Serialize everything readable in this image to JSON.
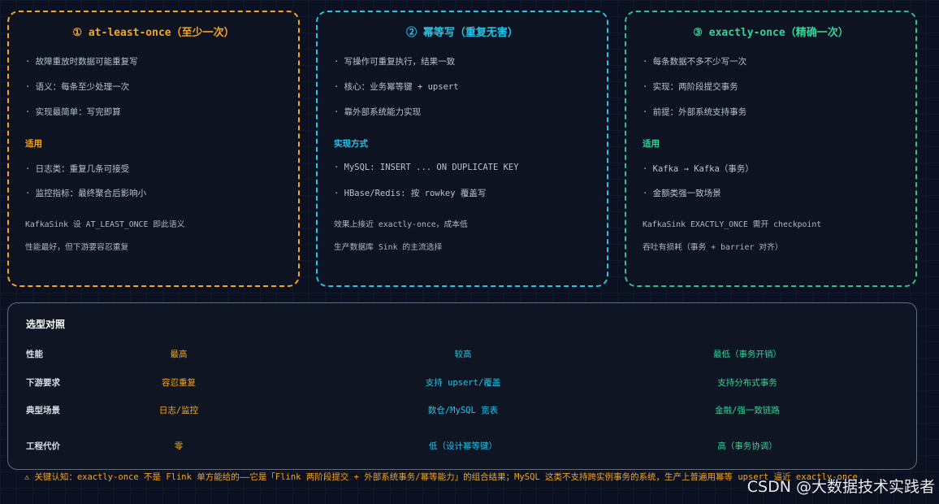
{
  "cards": [
    {
      "title": "① at-least-once（至少一次）",
      "points": [
        "· 故障重放时数据可能重复写",
        "· 语义：每条至少处理一次",
        "· 实现最简单：写完即算"
      ],
      "section": "适用",
      "items": [
        "· 日志类：重复几条可接受",
        "· 监控指标：最终聚合后影响小"
      ],
      "notes": [
        "KafkaSink 设 AT_LEAST_ONCE 即此语义",
        "性能最好，但下游要容忍重复"
      ]
    },
    {
      "title": "② 幂等写（重复无害）",
      "points": [
        "· 写操作可重复执行，结果一致",
        "· 核心：业务幂等键 + upsert",
        "· 靠外部系统能力实现"
      ],
      "section": "实现方式",
      "items": [
        "· MySQL: INSERT ... ON DUPLICATE KEY",
        "· HBase/Redis: 按 rowkey 覆盖写"
      ],
      "notes": [
        "效果上接近 exactly-once，成本低",
        "生产数据库 Sink 的主流选择"
      ]
    },
    {
      "title": "③ exactly-once（精确一次）",
      "points": [
        "· 每条数据不多不少写一次",
        "· 实现：两阶段提交事务",
        "· 前提：外部系统支持事务"
      ],
      "section": "适用",
      "items": [
        "· Kafka → Kafka（事务）",
        "· 金额类强一致场景"
      ],
      "notes": [
        "KafkaSink EXACTLY_ONCE 需开 checkpoint",
        "吞吐有损耗（事务 + barrier 对齐）"
      ]
    }
  ],
  "compare": {
    "title": "选型对照",
    "rows": [
      {
        "label": "性能",
        "v1": "最高",
        "v2": "较高",
        "v3": "最低（事务开销）"
      },
      {
        "label": "下游要求",
        "v1": "容忍重复",
        "v2": "支持 upsert/覆盖",
        "v3": "支持分布式事务"
      },
      {
        "label": "典型场景",
        "v1": "日志/监控",
        "v2": "数仓/MySQL 宽表",
        "v3": "金融/强一致链路"
      },
      {
        "label": "工程代价",
        "v1": "零",
        "v2": "低（设计幂等键）",
        "v3": "高（事务协调）"
      }
    ]
  },
  "footer": {
    "icon": "⚠",
    "text": "关键认知：exactly-once 不是 Flink 单方能给的——它是「Flink 两阶段提交 + 外部系统事务/幂等能力」的组合结果；MySQL 这类不支持跨实例事务的系统，生产上普遍用幂等 upsert 逼近 exactly-once"
  },
  "watermark": "CSDN @大数据技术实践者"
}
